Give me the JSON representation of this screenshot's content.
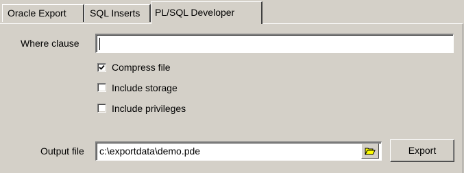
{
  "tabs": [
    {
      "label": "Oracle Export",
      "active": false
    },
    {
      "label": "SQL Inserts",
      "active": false
    },
    {
      "label": "PL/SQL Developer",
      "active": true
    }
  ],
  "where_clause": {
    "label": "Where clause",
    "value": ""
  },
  "options": [
    {
      "label": "Compress file",
      "checked": true
    },
    {
      "label": "Include storage",
      "checked": false
    },
    {
      "label": "Include privileges",
      "checked": false
    }
  ],
  "output_file": {
    "label": "Output file",
    "value": "c:\\exportdata\\demo.pde",
    "browse_icon": "folder-open-icon"
  },
  "export_button": {
    "label": "Export"
  }
}
